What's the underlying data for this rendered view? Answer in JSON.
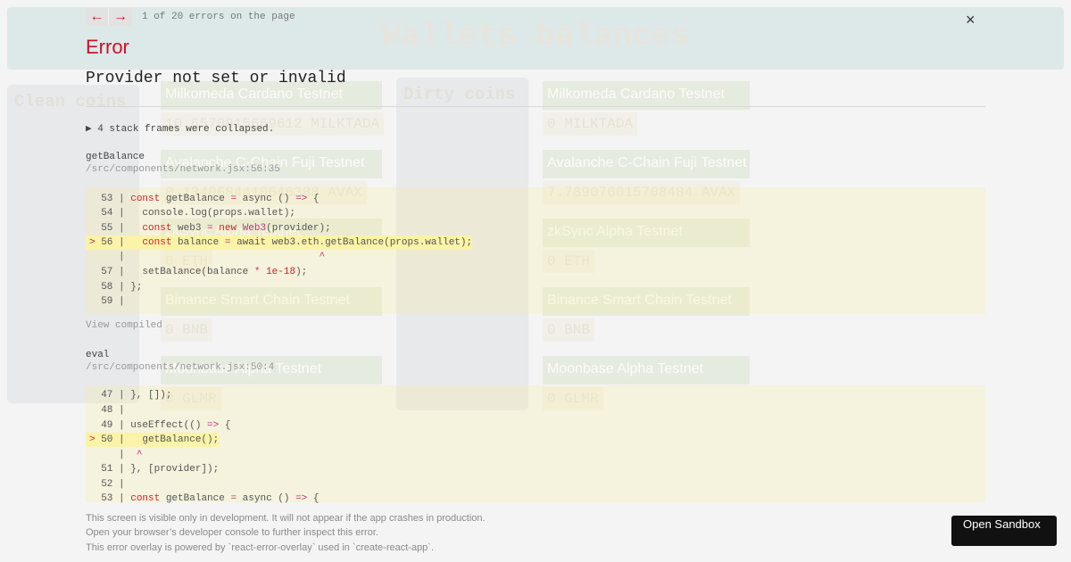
{
  "page": {
    "title": "Wallets balances",
    "clean": {
      "title": "Clean coins",
      "networks": [
        {
          "name": "Milkomeda Cardano Testnet",
          "balance": "10.6570815669612 MILKTADA"
        },
        {
          "name": "Avalanche C-Chain Fuji Testnet",
          "balance": "0.1340684410646388 AVAX"
        },
        {
          "name": "zkSync Alpha Testnet",
          "balance": "0 ETH"
        },
        {
          "name": "Binance Smart Chain Testnet",
          "balance": "0 BNB"
        },
        {
          "name": "Moonbase Alpha Testnet",
          "balance": "0 GLMR"
        }
      ]
    },
    "dirty": {
      "title": "Dirty coins",
      "networks": [
        {
          "name": "Milkomeda Cardano Testnet",
          "balance": "0 MILKTADA"
        },
        {
          "name": "Avalanche C-Chain Fuji Testnet",
          "balance": "7.789076015708484 AVAX"
        },
        {
          "name": "zkSync Alpha Testnet",
          "balance": "0 ETH"
        },
        {
          "name": "Binance Smart Chain Testnet",
          "balance": "0 BNB"
        },
        {
          "name": "Moonbase Alpha Testnet",
          "balance": "0 GLMR"
        }
      ]
    }
  },
  "overlay": {
    "prev": "←",
    "next": "→",
    "counter": "1 of 20 errors on the page",
    "close": "×",
    "header": "Error",
    "message": "Provider not set or invalid",
    "collapsed": "▶ 4 stack frames were collapsed.",
    "frames": [
      {
        "fn": "getBalance",
        "loc": "/src/components/network.jsx:56:35",
        "view_compiled": "View compiled"
      },
      {
        "fn": "eval",
        "loc": "/src/components/network.jsx:50:4"
      }
    ],
    "footer": [
      "This screen is visible only in development. It will not appear if the app crashes in production.",
      "Open your browser’s developer console to further inspect this error.",
      "This error overlay is powered by `react-error-overlay` used in `create-react-app`."
    ],
    "sandbox": "Open Sandbox",
    "accent": "#ce1126"
  }
}
